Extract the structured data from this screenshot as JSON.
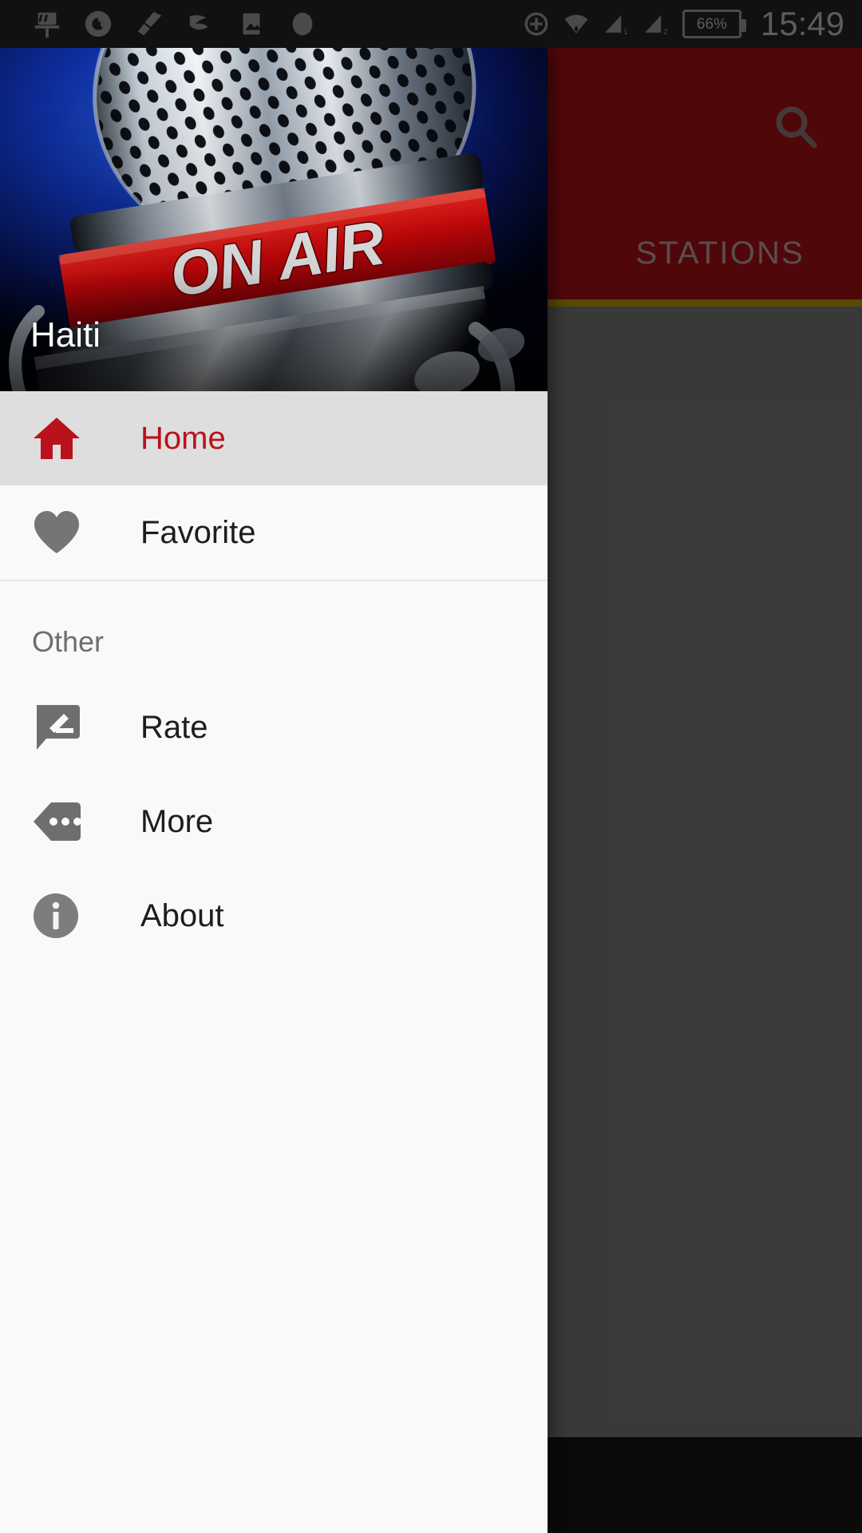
{
  "status_bar": {
    "icons": [
      "sd-card-icon",
      "chrome-icon",
      "clean-master-icon",
      "swift-key-icon",
      "gallery-icon",
      "generic-app-icon"
    ],
    "right_icons": [
      "location-add-icon",
      "wifi-icon",
      "signal-sim1-icon",
      "signal-sim2-icon"
    ],
    "sim1_label": "1",
    "sim2_label": "2",
    "battery_percent": "66%",
    "clock": "15:49"
  },
  "app_bar": {
    "background_color": "#7d0b10",
    "search_icon": "search-icon",
    "tab_label": "STATIONS",
    "tab_indicator_color": "#8a7506"
  },
  "player": {
    "button_icon": "pause-icon",
    "background_color": "#111112"
  },
  "drawer": {
    "header_title": "Haiti",
    "header_image": "on-air-microphone-photo",
    "accent_color": "#b9121b",
    "sections": [
      {
        "title": null,
        "items": [
          {
            "label": "Home",
            "icon": "home-icon",
            "selected": true
          },
          {
            "label": "Favorite",
            "icon": "heart-icon",
            "selected": false
          }
        ]
      },
      {
        "title": "Other",
        "items": [
          {
            "label": "Rate",
            "icon": "rate-review-icon",
            "selected": false
          },
          {
            "label": "More",
            "icon": "more-tag-icon",
            "selected": false
          },
          {
            "label": "About",
            "icon": "info-circle-icon",
            "selected": false
          }
        ]
      }
    ]
  }
}
